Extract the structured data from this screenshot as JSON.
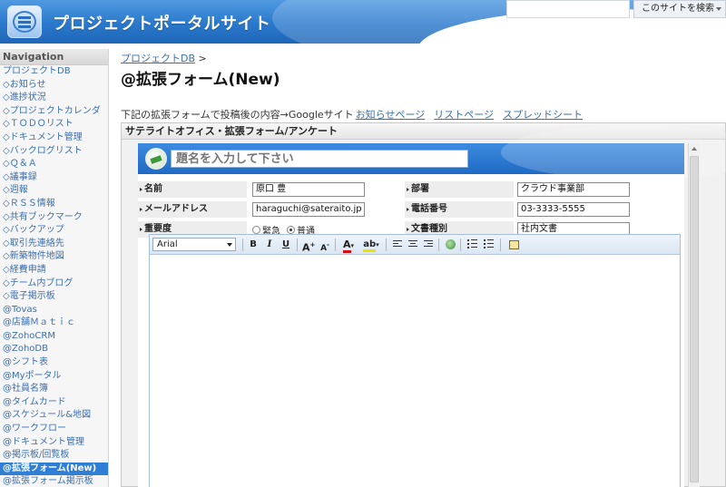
{
  "header": {
    "site_title": "プロジェクトポータルサイト",
    "search_button": "このサイトを検索"
  },
  "sidebar": {
    "title": "Navigation",
    "items": [
      {
        "label": "プロジェクトDB"
      },
      {
        "label": "◇お知らせ"
      },
      {
        "label": "◇進捗状況"
      },
      {
        "label": "◇プロジェクトカレンダ"
      },
      {
        "label": "◇ＴＯＤＯリスト"
      },
      {
        "label": "◇ドキュメント管理"
      },
      {
        "label": "◇バックログリスト"
      },
      {
        "label": "◇Ｑ＆Ａ"
      },
      {
        "label": "◇議事録"
      },
      {
        "label": "◇週報"
      },
      {
        "label": "◇ＲＳＳ情報"
      },
      {
        "label": "◇共有ブックマーク"
      },
      {
        "label": "◇バックアップ"
      },
      {
        "label": "◇取引先連絡先"
      },
      {
        "label": "◇新築物件地図"
      },
      {
        "label": "◇経費申請"
      },
      {
        "label": "◇チーム内ブログ"
      },
      {
        "label": "◇電子掲示板"
      },
      {
        "label": "@Tovas"
      },
      {
        "label": "@店舗Ｍａｔｉｃ"
      },
      {
        "label": "@ZohoCRM"
      },
      {
        "label": "@ZohoDB"
      },
      {
        "label": "@シフト表"
      },
      {
        "label": "@Myポータル"
      },
      {
        "label": "@社員名簿"
      },
      {
        "label": "@タイムカード"
      },
      {
        "label": "@スケジュール&地図"
      },
      {
        "label": "@ワークフロー"
      },
      {
        "label": "@ドキュメント管理"
      },
      {
        "label": "@掲示板/回覧板"
      },
      {
        "label": "@拡張フォーム(New)"
      },
      {
        "label": "@拡張フォーム掲示板"
      }
    ]
  },
  "main": {
    "breadcrumb_link": "プロジェクトDB",
    "breadcrumb_sep": ">",
    "page_title": "@拡張フォーム(New)",
    "info_text": "下記の拡張フォームで投稿後の内容→Googleサイト",
    "info_links": [
      "お知らせページ",
      "リストページ",
      "スプレッドシート"
    ],
    "gadget_title": "サテライトオフィス・拡張フォーム/アンケート",
    "form": {
      "title_placeholder": "題名を入力して下さい",
      "name_label": "名前",
      "name_value": "原口 豊",
      "dept_label": "部署",
      "dept_value": "クラウド事業部",
      "email_label": "メールアドレス",
      "email_value": "haraguchi@sateraito.jp",
      "phone_label": "電話番号",
      "phone_value": "03-3333-5555",
      "priority_label": "重要度",
      "priority_options": [
        "緊急",
        "普通"
      ],
      "doctype_label": "文書種別",
      "doctype_value": "社内文書"
    },
    "editor": {
      "font": "Arial",
      "bold": "B",
      "italic": "I",
      "underline": "U",
      "font_grow": "A",
      "font_shrink": "A",
      "text_color": "A",
      "highlight": "ab"
    }
  },
  "colors": {
    "header_blue": "#2a78cc",
    "link_blue": "#3a6fb0",
    "active_nav": "#2f7fd6"
  }
}
